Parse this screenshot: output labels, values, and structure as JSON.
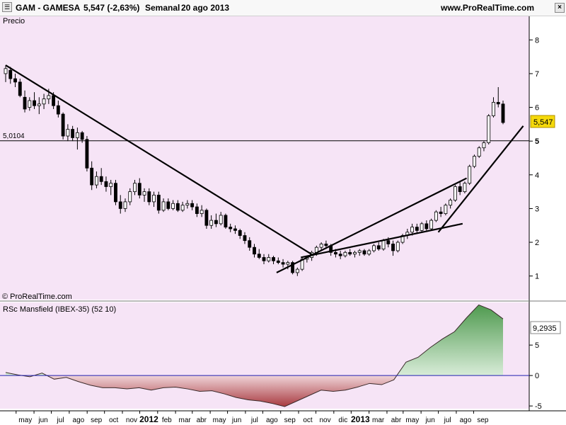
{
  "header": {
    "ticker": "GAM - GAMESA",
    "price_change": "5,547 (-2,63%)",
    "period": "Semanal",
    "date": "20 ago 2013",
    "site": "www.ProRealTime.com",
    "menu_icon": "menu-icon",
    "close_icon": "close-icon"
  },
  "colors": {
    "background": "#f6e4f6",
    "up_candle": "#ffffff",
    "down_candle": "#000000",
    "price_tag": "#f5d90a",
    "rs_positive": "#4f9a4f",
    "rs_negative": "#a83a40",
    "zero_line": "#2020b0"
  },
  "chart_data": [
    {
      "type": "candlestick",
      "panel_label": "Precio",
      "watermark": "© ProRealTime.com",
      "ylim": [
        0.3,
        8.7
      ],
      "yticks": [
        1,
        2,
        3,
        4,
        5,
        6,
        7,
        8
      ],
      "last_price_label": "5,547",
      "last_price": 5.547,
      "horizontal_line": {
        "label": "5,0104",
        "value": 5.0104
      },
      "x_axis_labels": [
        "may",
        "jun",
        "jul",
        "ago",
        "sep",
        "oct",
        "nov",
        "2012",
        "feb",
        "mar",
        "abr",
        "may",
        "jun",
        "jul",
        "ago",
        "sep",
        "oct",
        "nov",
        "dic",
        "2013",
        "mar",
        "abr",
        "may",
        "jun",
        "jul",
        "ago",
        "sep"
      ],
      "x_axis_bold": [
        "2012",
        "2013"
      ],
      "period": "weekly",
      "x_start": "2011-04-11",
      "x_end": "2013-08-19",
      "candles_ohlc": [
        [
          7.0,
          7.25,
          6.75,
          7.15
        ],
        [
          7.1,
          7.2,
          6.7,
          6.85
        ],
        [
          6.85,
          7.0,
          6.6,
          6.75
        ],
        [
          6.75,
          6.85,
          6.3,
          6.35
        ],
        [
          6.3,
          6.5,
          5.85,
          5.95
        ],
        [
          6.0,
          6.3,
          5.9,
          6.2
        ],
        [
          6.2,
          6.45,
          5.95,
          6.05
        ],
        [
          6.05,
          6.3,
          5.8,
          6.1
        ],
        [
          6.1,
          6.4,
          5.95,
          6.25
        ],
        [
          6.25,
          6.55,
          6.1,
          6.35
        ],
        [
          6.35,
          6.45,
          5.95,
          6.05
        ],
        [
          6.05,
          6.2,
          5.7,
          5.8
        ],
        [
          5.8,
          5.85,
          5.05,
          5.15
        ],
        [
          5.15,
          5.5,
          5.0,
          5.35
        ],
        [
          5.35,
          5.45,
          5.0,
          5.1
        ],
        [
          5.1,
          5.4,
          4.75,
          5.25
        ],
        [
          5.25,
          5.3,
          4.95,
          5.05
        ],
        [
          5.05,
          5.15,
          4.1,
          4.2
        ],
        [
          4.2,
          4.4,
          3.55,
          3.7
        ],
        [
          3.7,
          4.1,
          3.6,
          3.95
        ],
        [
          3.95,
          4.2,
          3.7,
          3.8
        ],
        [
          3.8,
          3.95,
          3.5,
          3.65
        ],
        [
          3.65,
          3.85,
          3.4,
          3.75
        ],
        [
          3.75,
          3.85,
          3.1,
          3.2
        ],
        [
          3.2,
          3.4,
          2.85,
          3.0
        ],
        [
          3.0,
          3.3,
          2.9,
          3.2
        ],
        [
          3.2,
          3.6,
          3.1,
          3.5
        ],
        [
          3.5,
          3.85,
          3.4,
          3.75
        ],
        [
          3.75,
          3.9,
          3.3,
          3.4
        ],
        [
          3.4,
          3.6,
          3.2,
          3.5
        ],
        [
          3.5,
          3.6,
          3.1,
          3.2
        ],
        [
          3.2,
          3.5,
          3.05,
          3.4
        ],
        [
          3.4,
          3.5,
          2.85,
          2.95
        ],
        [
          2.95,
          3.3,
          2.9,
          3.2
        ],
        [
          3.2,
          3.3,
          2.95,
          3.0
        ],
        [
          3.0,
          3.25,
          2.95,
          3.15
        ],
        [
          3.15,
          3.25,
          2.9,
          2.95
        ],
        [
          2.95,
          3.2,
          2.9,
          3.1
        ],
        [
          3.1,
          3.25,
          3.0,
          3.15
        ],
        [
          3.15,
          3.25,
          2.95,
          3.05
        ],
        [
          3.05,
          3.15,
          2.75,
          2.85
        ],
        [
          2.85,
          3.1,
          2.75,
          2.95
        ],
        [
          2.95,
          3.0,
          2.4,
          2.5
        ],
        [
          2.5,
          2.8,
          2.4,
          2.65
        ],
        [
          2.65,
          2.85,
          2.45,
          2.55
        ],
        [
          2.55,
          2.9,
          2.5,
          2.8
        ],
        [
          2.8,
          2.85,
          2.4,
          2.45
        ],
        [
          2.45,
          2.55,
          2.3,
          2.4
        ],
        [
          2.4,
          2.5,
          2.25,
          2.35
        ],
        [
          2.35,
          2.4,
          2.1,
          2.2
        ],
        [
          2.2,
          2.3,
          1.95,
          2.05
        ],
        [
          2.05,
          2.15,
          1.75,
          1.85
        ],
        [
          1.85,
          1.95,
          1.55,
          1.65
        ],
        [
          1.65,
          1.8,
          1.5,
          1.55
        ],
        [
          1.55,
          1.65,
          1.35,
          1.45
        ],
        [
          1.45,
          1.65,
          1.4,
          1.55
        ],
        [
          1.55,
          1.6,
          1.35,
          1.45
        ],
        [
          1.45,
          1.55,
          1.35,
          1.4
        ],
        [
          1.4,
          1.5,
          1.25,
          1.35
        ],
        [
          1.35,
          1.45,
          1.2,
          1.4
        ],
        [
          1.4,
          1.45,
          1.05,
          1.1
        ],
        [
          1.1,
          1.25,
          1.0,
          1.2
        ],
        [
          1.2,
          1.55,
          1.15,
          1.5
        ],
        [
          1.5,
          1.6,
          1.4,
          1.55
        ],
        [
          1.55,
          1.75,
          1.45,
          1.7
        ],
        [
          1.7,
          1.9,
          1.6,
          1.85
        ],
        [
          1.85,
          2.0,
          1.75,
          1.95
        ],
        [
          1.95,
          2.05,
          1.8,
          1.9
        ],
        [
          1.9,
          1.95,
          1.6,
          1.7
        ],
        [
          1.7,
          1.8,
          1.55,
          1.65
        ],
        [
          1.65,
          1.75,
          1.5,
          1.6
        ],
        [
          1.6,
          1.75,
          1.55,
          1.7
        ],
        [
          1.7,
          1.8,
          1.6,
          1.65
        ],
        [
          1.65,
          1.75,
          1.55,
          1.7
        ],
        [
          1.7,
          1.8,
          1.6,
          1.75
        ],
        [
          1.75,
          1.8,
          1.6,
          1.65
        ],
        [
          1.65,
          1.8,
          1.6,
          1.75
        ],
        [
          1.75,
          1.95,
          1.7,
          1.9
        ],
        [
          1.9,
          2.0,
          1.75,
          1.8
        ],
        [
          1.8,
          2.1,
          1.75,
          2.05
        ],
        [
          2.05,
          2.15,
          1.85,
          1.95
        ],
        [
          1.95,
          2.05,
          1.6,
          1.75
        ],
        [
          1.75,
          2.05,
          1.7,
          2.0
        ],
        [
          2.0,
          2.25,
          1.95,
          2.2
        ],
        [
          2.2,
          2.4,
          2.1,
          2.3
        ],
        [
          2.3,
          2.55,
          2.2,
          2.45
        ],
        [
          2.45,
          2.55,
          2.25,
          2.35
        ],
        [
          2.35,
          2.6,
          2.3,
          2.55
        ],
        [
          2.55,
          2.65,
          2.35,
          2.4
        ],
        [
          2.4,
          2.7,
          2.35,
          2.65
        ],
        [
          2.65,
          2.95,
          2.6,
          2.9
        ],
        [
          2.9,
          3.05,
          2.75,
          2.85
        ],
        [
          2.85,
          3.15,
          2.8,
          3.1
        ],
        [
          3.1,
          3.3,
          3.0,
          3.25
        ],
        [
          3.25,
          3.7,
          3.2,
          3.65
        ],
        [
          3.65,
          3.8,
          3.4,
          3.5
        ],
        [
          3.5,
          3.8,
          3.45,
          3.75
        ],
        [
          3.75,
          4.3,
          3.7,
          4.25
        ],
        [
          4.25,
          4.6,
          4.2,
          4.55
        ],
        [
          4.55,
          4.85,
          4.5,
          4.8
        ],
        [
          4.8,
          5.0,
          4.7,
          4.95
        ],
        [
          4.95,
          5.8,
          4.9,
          5.75
        ],
        [
          5.75,
          6.3,
          5.7,
          6.15
        ],
        [
          6.15,
          6.6,
          6.0,
          6.1
        ],
        [
          6.1,
          6.2,
          5.5,
          5.55
        ]
      ],
      "trendlines": [
        {
          "from": [
            "2011-04-11",
            7.25
          ],
          "to": [
            "2012-09-24",
            1.62
          ]
        },
        {
          "from": [
            "2012-07-23",
            1.1
          ],
          "to": [
            "2013-06-17",
            3.9
          ]
        },
        {
          "from": [
            "2012-09-03",
            1.55
          ],
          "to": [
            "2013-06-10",
            2.55
          ]
        },
        {
          "from": [
            "2013-04-29",
            2.3
          ],
          "to": [
            "2013-09-23",
            5.45
          ]
        }
      ]
    },
    {
      "type": "area",
      "title": "RSc Mansfield (IBEX-35) (52 10)",
      "last_value_label": "9,2935",
      "last_value": 9.2935,
      "ylim": [
        -5.8,
        12
      ],
      "yticks": [
        -5,
        0,
        5
      ],
      "baseline": 0,
      "x": [
        "2011-04-11",
        "2011-05-02",
        "2011-05-23",
        "2011-06-13",
        "2011-07-04",
        "2011-07-25",
        "2011-08-15",
        "2011-09-05",
        "2011-09-26",
        "2011-10-17",
        "2011-11-07",
        "2011-11-28",
        "2011-12-19",
        "2012-01-09",
        "2012-01-30",
        "2012-02-20",
        "2012-03-12",
        "2012-04-02",
        "2012-04-23",
        "2012-05-14",
        "2012-06-04",
        "2012-06-25",
        "2012-07-16",
        "2012-08-06",
        "2012-08-27",
        "2012-09-17",
        "2012-10-08",
        "2012-10-29",
        "2012-11-19",
        "2012-12-10",
        "2012-12-31",
        "2013-01-21",
        "2013-02-11",
        "2013-03-04",
        "2013-03-25",
        "2013-04-15",
        "2013-05-06",
        "2013-05-27",
        "2013-06-17",
        "2013-07-08",
        "2013-07-29",
        "2013-08-19"
      ],
      "values": [
        0.5,
        0.1,
        -0.2,
        0.4,
        -0.6,
        -0.3,
        -1.0,
        -1.6,
        -2.0,
        -2.0,
        -2.2,
        -2.0,
        -2.4,
        -2.0,
        -1.9,
        -2.2,
        -2.6,
        -2.5,
        -3.0,
        -3.6,
        -4.0,
        -4.2,
        -4.6,
        -5.1,
        -4.2,
        -3.3,
        -2.4,
        -2.6,
        -2.4,
        -1.9,
        -1.3,
        -1.5,
        -0.7,
        2.2,
        3.0,
        4.6,
        6.0,
        7.2,
        9.5,
        11.6,
        10.8,
        9.3
      ]
    }
  ]
}
